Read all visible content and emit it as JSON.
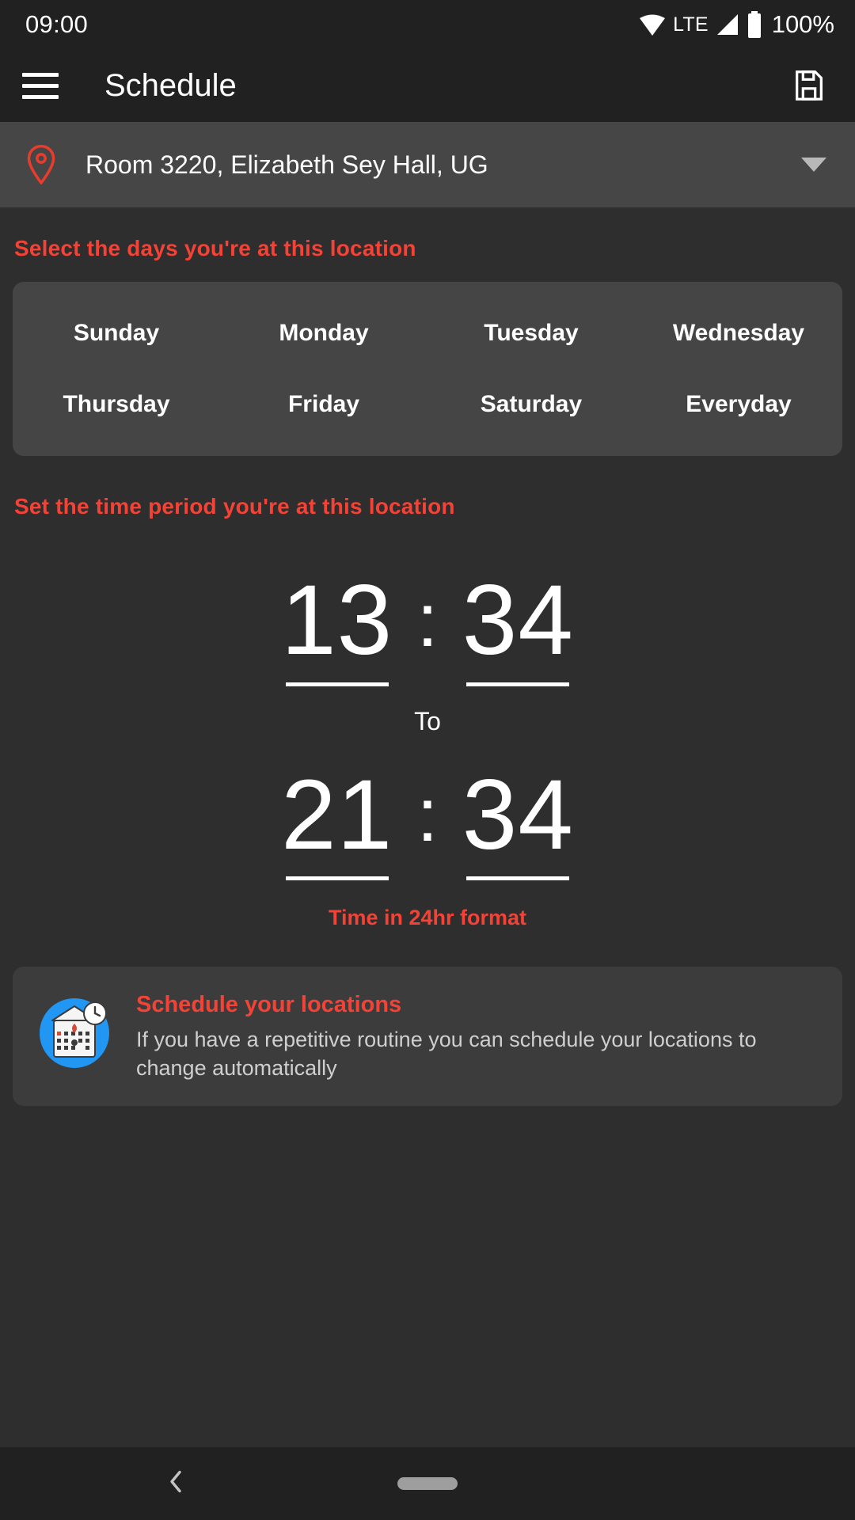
{
  "status_bar": {
    "clock": "09:00",
    "network_label": "LTE",
    "battery_label": "100%",
    "icons": [
      "wifi-icon",
      "cellular-signal-icon",
      "battery-icon"
    ]
  },
  "app_bar": {
    "menu_icon": "hamburger-menu-icon",
    "title": "Schedule",
    "action_icon": "save-icon"
  },
  "location_selector": {
    "icon": "map-pin-icon",
    "value": "Room 3220, Elizabeth Sey Hall, UG",
    "dropdown_icon": "chevron-down-icon"
  },
  "days_section": {
    "label": "Select the days you're at this location",
    "rows": [
      [
        "Sunday",
        "Monday",
        "Tuesday",
        "Wednesday"
      ],
      [
        "Thursday",
        "Friday",
        "Saturday",
        "Everyday"
      ]
    ]
  },
  "time_section": {
    "label": "Set the time period you're at this location",
    "start": {
      "hour": "13",
      "separator": ":",
      "minute": "34"
    },
    "to_label": "To",
    "end": {
      "hour": "21",
      "separator": ":",
      "minute": "34"
    },
    "format_note": "Time in 24hr format"
  },
  "info_card": {
    "icon": "calendar-clock-icon",
    "title": "Schedule your locations",
    "body": "If you have a repetitive routine you can schedule your locations to change automatically"
  },
  "nav_bar": {
    "back_icon": "back-chevron-icon",
    "home_pill": "home-gesture-pill"
  },
  "colors": {
    "accent_red": "#f44336",
    "background": "#2e2e2e",
    "bar_background": "#212121",
    "card_background": "#454545",
    "location_background": "#464646",
    "info_card_background": "#3c3c3c",
    "text_primary": "#ffffff",
    "text_secondary": "#cfcfcf"
  }
}
